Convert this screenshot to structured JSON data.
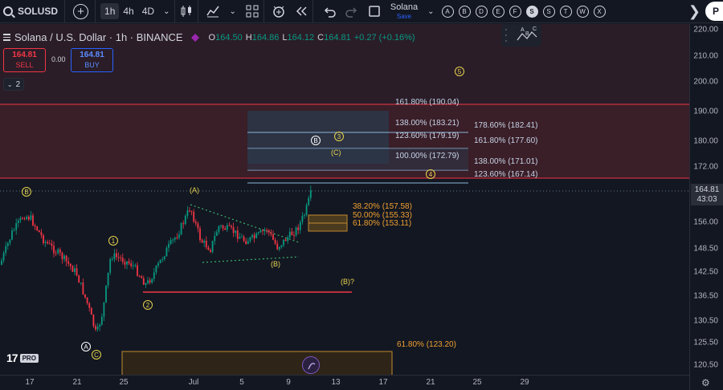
{
  "toolbar": {
    "symbol": "SOLUSD",
    "timeframes": [
      "1h",
      "4h",
      "4D"
    ],
    "active_timeframe": "1h",
    "layout_name": "Solana",
    "layout_status": "Save",
    "letter_buttons": [
      "A",
      "B",
      "D",
      "E",
      "F",
      "S",
      "S",
      "T",
      "W",
      "X"
    ],
    "profile_initial": "P"
  },
  "legend": {
    "title": "Solana / U.S. Dollar · 1h · BINANCE",
    "open_label": "O",
    "open": "164.50",
    "high_label": "H",
    "high": "164.86",
    "low_label": "L",
    "low": "164.12",
    "close_label": "C",
    "close": "164.81",
    "change": "+0.27 (+0.16%)"
  },
  "trade": {
    "sell_price": "164.81",
    "sell_label": "SELL",
    "spread": "0.00",
    "buy_price": "164.81",
    "buy_label": "BUY"
  },
  "collapse_count": "2",
  "price_axis": {
    "ticks": [
      "220.00",
      "210.00",
      "200.00",
      "190.00",
      "180.00",
      "172.00",
      "164.00",
      "156.00",
      "148.50",
      "142.50",
      "136.50",
      "130.50",
      "125.50",
      "120.50"
    ],
    "current_price": "164.81",
    "countdown": "43:03"
  },
  "time_axis": {
    "ticks": [
      "17",
      "21",
      "25",
      "Jul",
      "5",
      "9",
      "13",
      "17",
      "21",
      "25",
      "29"
    ]
  },
  "fib_labels": {
    "f1618_upper": "161.80% (190.04)",
    "f138_upper": "138.00% (183.21)",
    "f1236_upper": "123.60% (179.19)",
    "f100": "100.00% (172.79)",
    "f1786": "178.60% (182.41)",
    "f1618_right": "161.80% (177.60)",
    "f138_right": "138.00% (171.01)",
    "f1236_right": "123.60% (167.14)",
    "r382": "38.20% (157.58)",
    "r50": "50.00% (155.33)",
    "r618": "61.80% (153.11)",
    "r618_low": "61.80% (123.20)"
  },
  "wave_labels": {
    "w1": "1",
    "w2": "2",
    "w3": "3",
    "w4": "4",
    "w5": "5",
    "A_paren": "(A)",
    "B_paren": "(B)",
    "C_paren": "(C)",
    "B_paren_q": "(B)?",
    "A_circ": "A",
    "B_circ": "B",
    "C_circ": "C",
    "B_circ_left": "B"
  },
  "branding": {
    "logo": "17",
    "tier": "PRO"
  },
  "colors": {
    "background": "#131722",
    "up": "#089981",
    "down": "#f23645",
    "wave": "#e8d44d",
    "fib_orange": "#f0a030",
    "fib_blue": "#8ab4d8"
  }
}
